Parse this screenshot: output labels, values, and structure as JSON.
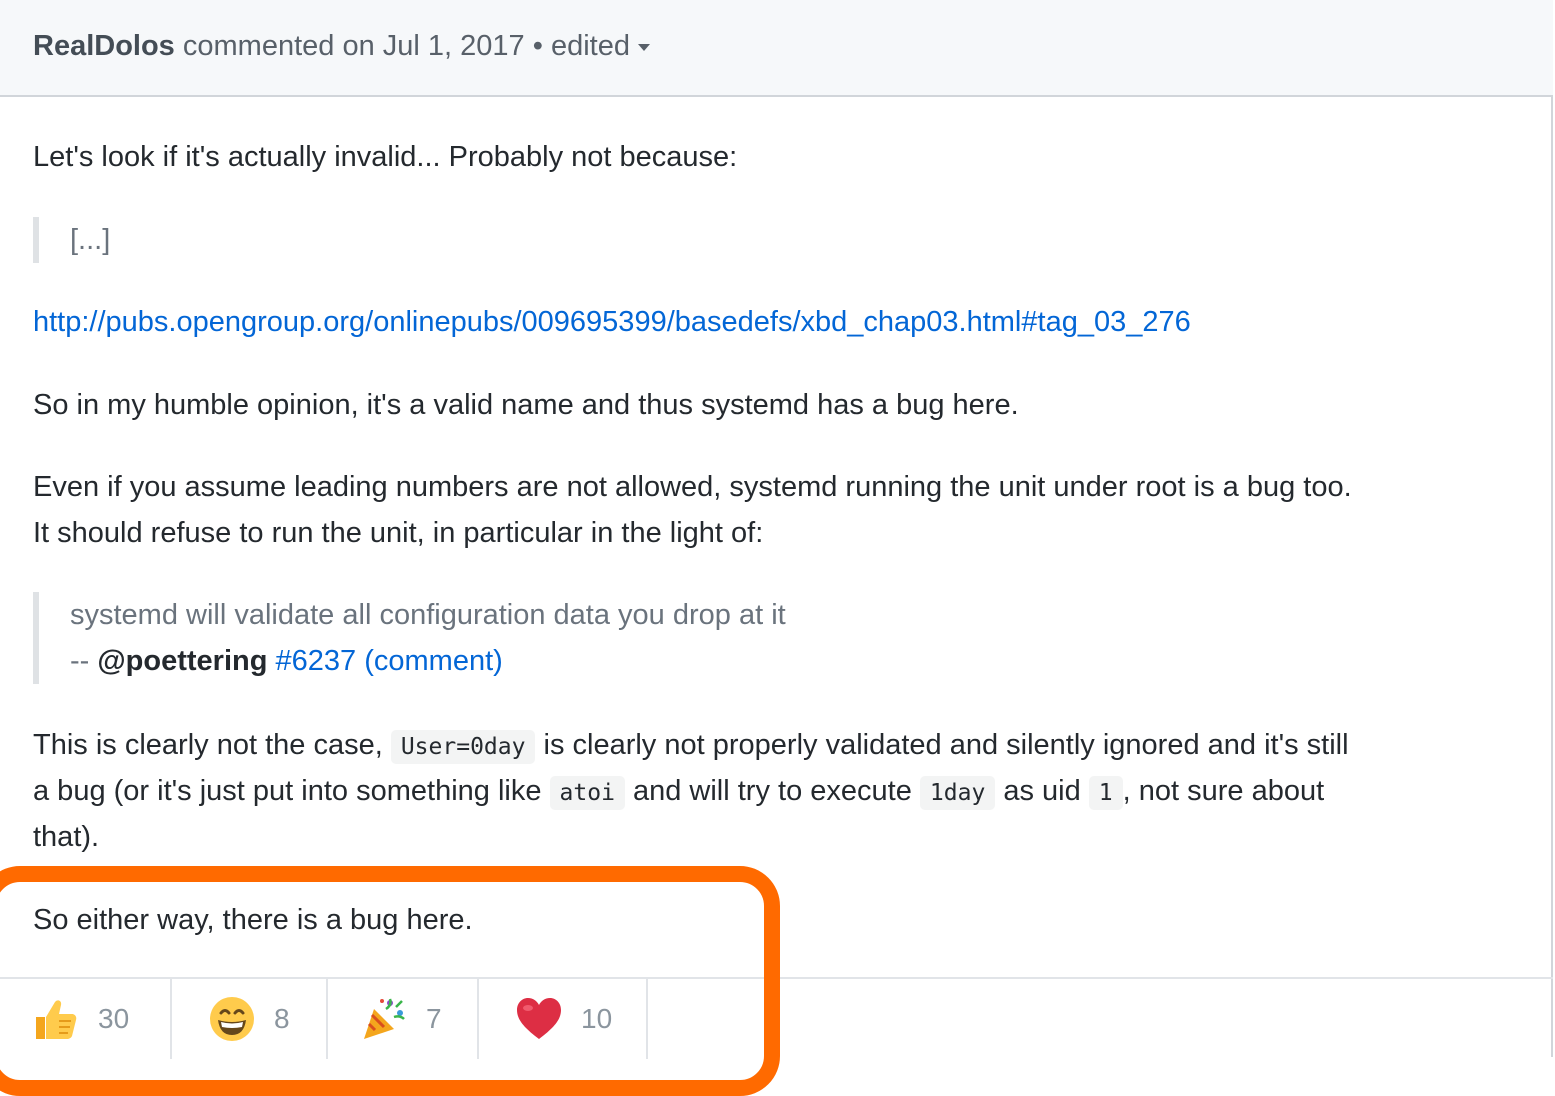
{
  "header": {
    "author": "RealDolos",
    "action": "commented on Jul 1, 2017 •",
    "edited": "edited"
  },
  "body": {
    "p1": "Let's look if it's actually invalid... Probably not because:",
    "quote1": "[...]",
    "link": "http://pubs.opengroup.org/onlinepubs/009695399/basedefs/xbd_chap03.html#tag_03_276",
    "p2": "So in my humble opinion, it's a valid name and thus systemd has a bug here.",
    "p3_line1": "Even if you assume leading numbers are not allowed, systemd running the unit under root is a bug too.",
    "p3_line2": "It should refuse to run the unit, in particular in the light of:",
    "quote2_line1": "systemd will validate all configuration data you drop at it",
    "quote2_prefix": "-- ",
    "quote2_mention": "@poettering",
    "quote2_ref": "#6237",
    "quote2_comment": "(comment)",
    "p4_a": "This is clearly not the case, ",
    "p4_code1": "User=0day",
    "p4_b": " is clearly not properly validated and silently ignored and it's still",
    "p4_c": "a bug (or it's just put into something like ",
    "p4_code2": "atoi",
    "p4_d": " and will try to execute ",
    "p4_code3": "1day",
    "p4_e": " as uid ",
    "p4_code4": "1",
    "p4_f": ", not sure about",
    "p4_g": "that).",
    "p5": "So either way, there is a bug here."
  },
  "reactions": [
    {
      "icon": "thumbs-up-icon",
      "count": "30"
    },
    {
      "icon": "smile-icon",
      "count": "8"
    },
    {
      "icon": "party-popper-icon",
      "count": "7"
    },
    {
      "icon": "heart-icon",
      "count": "10"
    }
  ],
  "colors": {
    "link": "#0366d6",
    "highlight": "#ff6a00",
    "header_bg": "#f6f8fa"
  }
}
